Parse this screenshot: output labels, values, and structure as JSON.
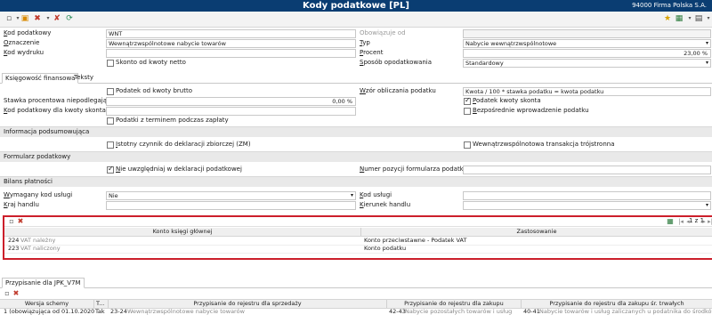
{
  "header": {
    "title": "Kody podatkowe [PL]",
    "company": "94000  Firma Polska S.A."
  },
  "form": {
    "kod_podatkowy_label": "Kod podatkowy",
    "kod_podatkowy_value": "WNT",
    "obowiazuje_od_label": "Obowiązuje od",
    "oznaczenie_label": "Oznaczenie",
    "oznaczenie_value": "Wewnątrzwspólnotowe nabycie towarów",
    "typ_label": "Typ",
    "typ_value": "Nabycie wewnątrzwspólnotowe",
    "kod_wydruku_label": "Kod wydruku",
    "procent_label": "Procent",
    "procent_value": "23,00 %",
    "skonto_label": "Skonto od kwoty netto",
    "sposob_label": "Sposób opodatkowania",
    "sposob_value": "Standardowy"
  },
  "tabs": [
    "Księgowość finansowa",
    "Teksty"
  ],
  "ksiegowosc": {
    "podatek_brutto": "Podatek od kwoty brutto",
    "wzor_label": "Wzór obliczania podatku",
    "wzor_value": "Kwota / 100 * stawka podatku = kwota podatku",
    "stawka_label": "Stawka procentowa niepodlegająca p...",
    "stawka_value": "0,00 %",
    "podatek_skonta": "Podatek kwoty skonta",
    "kod_skonta_label": "Kod podatkowy dla kwoty skonta",
    "bezposrednie": "Bezpośrednie wprowadzenie podatku",
    "terminem": "Podatki z terminem podczas zapłaty"
  },
  "informacja": {
    "title": "Informacja podsumowująca",
    "istotny": "Istotny czynnik do deklaracji zbiorczej (ZM)",
    "transakcja": "Wewnątrzwspólnotowa transakcja trójstronna"
  },
  "formularz": {
    "title": "Formularz podatkowy",
    "nie_uwzgledniaj": "Nie uwzględniaj w deklaracji podatkowej",
    "numer_label": "Numer pozycji formularza podatkowe..."
  },
  "bilans": {
    "title": "Bilans płatności",
    "wymagany_label": "Wymagany kod usługi",
    "wymagany_value": "Nie",
    "kod_uslugi_label": "Kod usługi",
    "kraj_label": "Kraj handlu",
    "kierunek_label": "Kierunek handlu"
  },
  "grid": {
    "pager": "1 z 1",
    "columns": [
      "Konto księgi głównej",
      "Zastosowanie"
    ],
    "rows": [
      {
        "code": "224",
        "name": "VAT należny",
        "use": "Konto przeciwstawne - Podatek VAT"
      },
      {
        "code": "223",
        "name": "VAT naliczony",
        "use": "Konto podatku"
      }
    ]
  },
  "bottom": {
    "tab": "Przypisanie dla JPK_V7M",
    "columns": [
      "Wersja schemy",
      "T...",
      "Przypisanie do rejestru dla sprzedaży",
      "Przypisanie do rejestru dla zakupu",
      "Przypisanie do rejestru dla zakupu śr. trwałych"
    ],
    "row": {
      "wersja": "1 (obowiązująca od 01.10.2020)",
      "t": "Tak",
      "sprzedaz_code": "23-24",
      "sprzedaz_name": "Wewnątrzwspólnotowe nabycie towarów",
      "zakup_code": "42-43",
      "zakup_name": "Nabycie pozostałych towarów i usług",
      "trwale_code": "40-41",
      "trwale_name": "Nabycie towarów i usług zaliczanych u podatnika do środków trwałych"
    }
  },
  "colors": {
    "title_bar": "#0a3d72",
    "highlight": "#cc1f2b"
  }
}
